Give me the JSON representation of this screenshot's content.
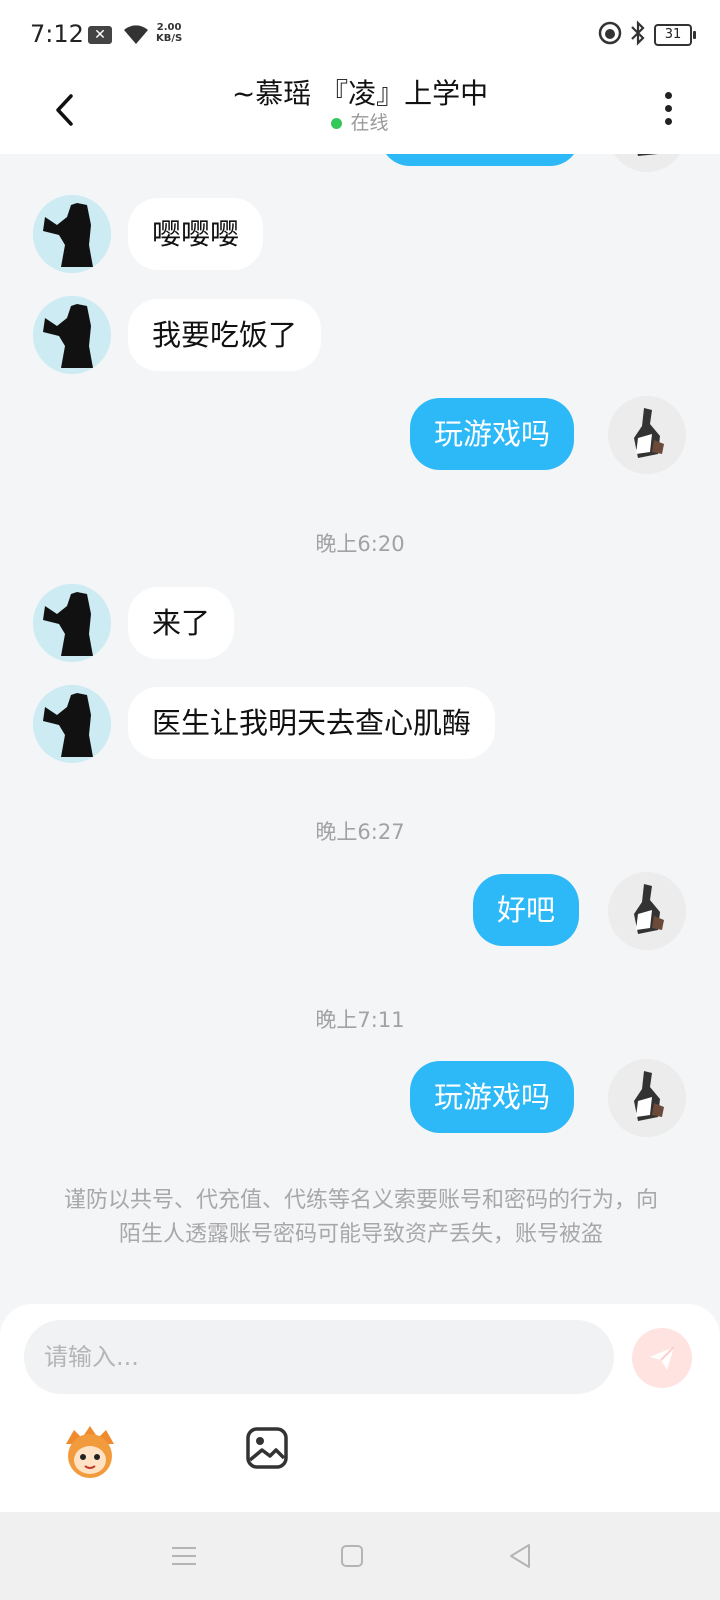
{
  "status_bar": {
    "time": "7:12",
    "net_speed_value": "2.00",
    "net_speed_unit": "KB/S",
    "battery": "31"
  },
  "header": {
    "title": "~慕瑶 『凌』上学中",
    "status": "在线",
    "status_color": "#34c759"
  },
  "colors": {
    "sent_bubble": "#2db8f7",
    "received_bubble": "#ffffff",
    "background": "#f4f5f7"
  },
  "messages": {
    "m1": "嘤嘤嘤",
    "m2": "我要吃饭了",
    "m3": "玩游戏吗",
    "t1": "晚上6:20",
    "m4": "来了",
    "m5": "医生让我明天去查心肌酶",
    "t2": "晚上6:27",
    "m6": "好吧",
    "t3": "晚上7:11",
    "m7": "玩游戏吗"
  },
  "warning_text": "谨防以共号、代充值、代练等名义索要账号和密码的行为，向陌生人透露账号密码可能导致资产丢失，账号被盗",
  "composer": {
    "placeholder": "请输入...",
    "value": ""
  },
  "icons": {
    "back": "chevron-left-icon",
    "more": "more-vertical-icon",
    "send": "send-icon",
    "emoji": "emoji-mascot-icon",
    "image": "image-icon",
    "nav_menu": "menu-icon",
    "nav_home": "square-icon",
    "nav_back": "triangle-back-icon"
  }
}
